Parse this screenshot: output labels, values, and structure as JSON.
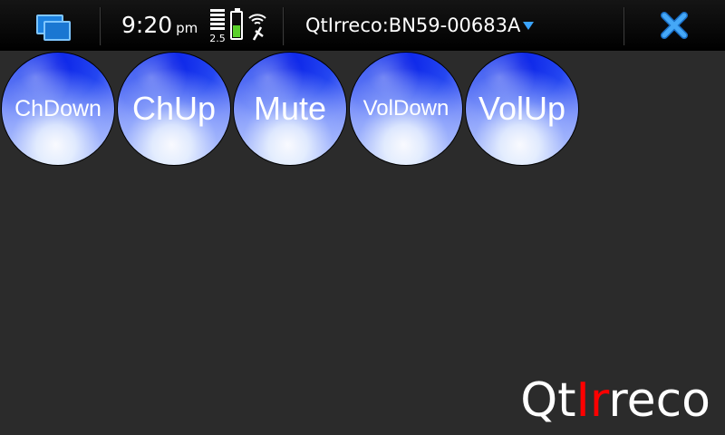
{
  "statusbar": {
    "time": "9:20",
    "ampm": "pm",
    "network": "2.5",
    "title": "QtIrreco:BN59-00683A",
    "icons": {
      "switcher": "task-switcher-icon",
      "signal": "signal-strength-icon",
      "battery": "battery-icon",
      "wifi": "wifi-icon",
      "dropdown": "dropdown-arrow-icon",
      "close": "close-icon"
    }
  },
  "buttons": [
    {
      "label": "ChDown"
    },
    {
      "label": "ChUp"
    },
    {
      "label": "Mute"
    },
    {
      "label": "VolDown"
    },
    {
      "label": "VolUp"
    }
  ],
  "logo": {
    "part1": "Qt",
    "part2": "Ir",
    "part3": "reco"
  },
  "colors": {
    "background": "#2b2b2b",
    "accent": "#1d82e0",
    "logo_red": "#ff0000",
    "button_blue": "#0a22e8"
  }
}
